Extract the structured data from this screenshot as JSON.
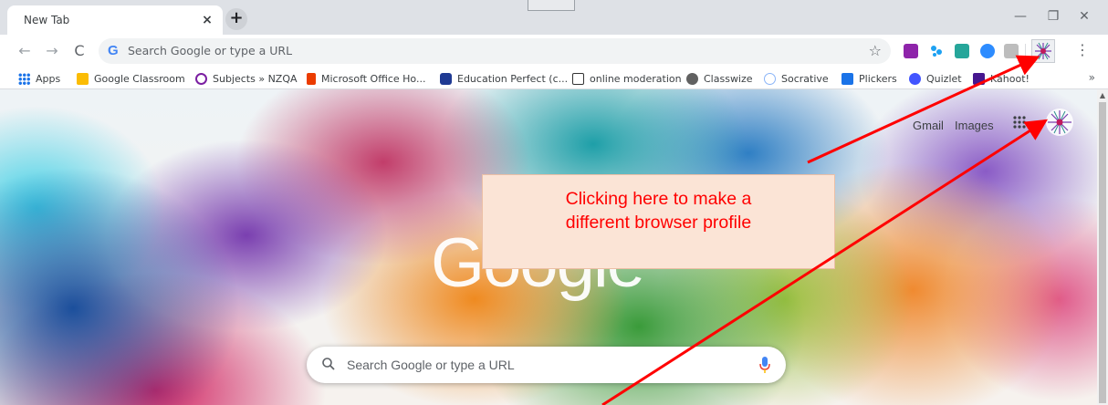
{
  "tab": {
    "title": "New Tab",
    "close_glyph": "×",
    "new_tab_glyph": "+"
  },
  "window": {
    "minimize": "—",
    "maximize": "❐",
    "close": "✕"
  },
  "toolbar": {
    "back": "←",
    "forward": "→",
    "reload": "C",
    "omnibox_g": "G",
    "omnibox_placeholder": "Search Google or type a URL",
    "star": "☆",
    "menu": "⋮",
    "extensions": [
      "onenote-icon",
      "tweetdeck-icon",
      "classroom-ext-icon",
      "zoom-icon",
      "pdf-icon"
    ],
    "profile_icon": "profile-avatar-icon"
  },
  "bookmarks": [
    {
      "label": "Apps",
      "icon": "apps-grid-icon",
      "color": "#1a73e8"
    },
    {
      "label": "Google Classroom",
      "icon": "classroom-icon",
      "color": "#fbbc04"
    },
    {
      "label": "Subjects » NZQA",
      "icon": "nzqa-icon",
      "color": "#7b1fa2"
    },
    {
      "label": "Microsoft Office Ho...",
      "icon": "office-icon",
      "color": "#eb3c00"
    },
    {
      "label": "Education Perfect (c...",
      "icon": "education-perfect-icon",
      "color": "#1f3a93"
    },
    {
      "label": "online moderation",
      "icon": "moderation-icon",
      "color": "#333333"
    },
    {
      "label": "Classwize",
      "icon": "classwize-icon",
      "color": "#616161"
    },
    {
      "label": "Socrative",
      "icon": "socrative-icon",
      "color": "#8ab4f8"
    },
    {
      "label": "Plickers",
      "icon": "plickers-icon",
      "color": "#1a73e8"
    },
    {
      "label": "Quizlet",
      "icon": "quizlet-icon",
      "color": "#4255ff"
    },
    {
      "label": "Kahoot!",
      "icon": "kahoot-icon",
      "color": "#46178f"
    }
  ],
  "bookmarks_more": "»",
  "page": {
    "gmail": "Gmail",
    "images": "Images",
    "logo": "Google",
    "search_placeholder": "Search Google or type a URL"
  },
  "annotation": {
    "text_line1": "Clicking here to make a",
    "text_line2": "different browser profile",
    "color": "#ff0000"
  }
}
